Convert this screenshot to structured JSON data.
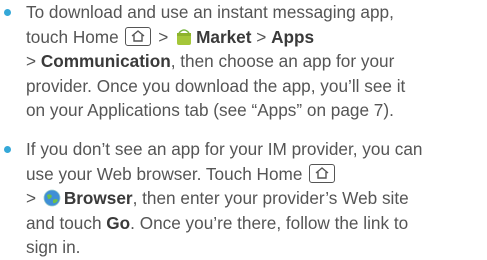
{
  "items": [
    {
      "l1": "To download and use an instant messaging app,",
      "l2_pre": "touch Home",
      "l2_sep1": ">",
      "l2_market": "Market",
      "l2_sep2": ">",
      "l2_apps": "Apps",
      "l3_sep": ">",
      "l3_comm": "Communication",
      "l3_post": ", then choose an app for your",
      "l4": "provider. Once you download the app, you’ll see it",
      "l5": "on your Applications tab (see “Apps” on page 7)."
    },
    {
      "l1": "If you don’t see an app for your IM provider, you can",
      "l2": "use your Web browser. Touch Home",
      "l3_sep": ">",
      "l3_browser": "Browser",
      "l3_post": ", then enter your provider’s Web site",
      "l4_pre": "and touch",
      "l4_go": "Go",
      "l4_post": ". Once you’re there, follow the link to",
      "l5": "sign in."
    }
  ],
  "icons": {
    "home": "home-key-icon",
    "market": "android-market-icon",
    "browser": "browser-globe-icon"
  },
  "colors": {
    "bullet": "#35a8d8",
    "text": "#555555",
    "bold": "#3a3a3a"
  }
}
